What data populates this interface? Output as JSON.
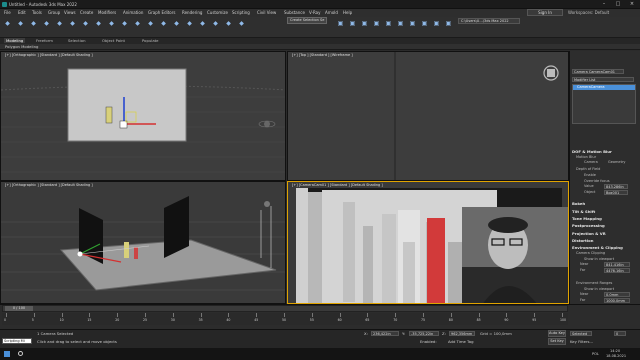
{
  "window": {
    "title": "Untitled - Autodesk 3ds Max 2022"
  },
  "menu": [
    "File",
    "Edit",
    "Tools",
    "Group",
    "Views",
    "Create",
    "Modifiers",
    "Animation",
    "Graph Editors",
    "Rendering",
    "Customize",
    "Scripting",
    "Civil View",
    "Substance",
    "V-Ray",
    "Arnold",
    "Help"
  ],
  "signin": "Sign In",
  "workspaces_label": "Workspaces: Default",
  "toolbar": {
    "selection_set": "Create Selection Se",
    "project_path": "C:\\Users\\U…\\3ds Max 2022"
  },
  "ribbon": {
    "tabs": [
      "Modeling",
      "Freeform",
      "Selection",
      "Object Paint",
      "Populate"
    ],
    "sub": "Polygon Modeling"
  },
  "viewports": {
    "top_left": "[+] [Orthographic ] [Standard ] [Default Shading ]",
    "top_right": "[+] [Top ] [Standard ] [Wireframe ]",
    "bottom_left": "[+] [Orthographic ] [Standard ] [Default Shading ]",
    "bottom_right": "[+] [CameraCam01 ] [Standard ] [Default Shading ]"
  },
  "command_panel": {
    "object_name": "Camera CameraCam01",
    "modifier_list": "Modifier List",
    "stack_item": "CameraCamera",
    "sections": [
      {
        "title": "DOF & Motion Blur"
      },
      {
        "title": "Bokeh"
      },
      {
        "title": "Tilt & Shift"
      },
      {
        "title": "Tone Mapping"
      },
      {
        "title": "Postprocessing"
      },
      {
        "title": "Projection & VR"
      },
      {
        "title": "Distortion"
      },
      {
        "title": "Environment & Clipping"
      }
    ],
    "rows": {
      "motion_blur": "Motion Blur",
      "camera": "Camera",
      "geometry": "Geometry",
      "depth_of_field": "Depth of Field",
      "enable": "Enable",
      "override_focus": "Override focus",
      "value": "Value",
      "value_val": "843.286in",
      "object": "Object",
      "object_val": "Box001",
      "camera_clipping": "Camera Clipping",
      "show_in_viewport": "Show in viewport",
      "near": "Near",
      "near_val": "841.416in",
      "far": "Far",
      "far_val": "4476.16in",
      "env_ranges": "Environment Ranges",
      "show_in_viewport2": "Show in viewport",
      "near2": "Near",
      "near2_val": "0.0mm",
      "far2": "Far",
      "far2_val": "1000.0mm"
    }
  },
  "timeline": {
    "frame": "0 / 100",
    "ticks": [
      "0",
      "5",
      "10",
      "15",
      "20",
      "25",
      "30",
      "35",
      "40",
      "45",
      "50",
      "55",
      "60",
      "65",
      "70",
      "75",
      "80",
      "85",
      "90",
      "95",
      "100"
    ]
  },
  "status": {
    "script": "Scripting Mi",
    "selected": "1 Camera Selected",
    "prompt": "Click and drag to select and move objects",
    "x_label": "X:",
    "x_val": "236,422in",
    "y_label": "Y:",
    "y_val": "-35,725,22in",
    "z_label": "Z:",
    "z_val": "962,356mm",
    "grid": "Grid = 100,0mm",
    "enabled": "Enabled:",
    "add_time_tag": "Add Time Tag",
    "auto_key": "Auto Key",
    "selected_dd": "Selected",
    "set_key": "Set Key",
    "key_filters": "Key Filters...",
    "frame_val": "0"
  },
  "taskbar": {
    "time": "14:20",
    "date": "18.08.2021",
    "lang": "POL"
  },
  "colors": {
    "accent": "#4a90d9",
    "active_border": "#e0a300",
    "red_bar": "#d23a3a"
  }
}
